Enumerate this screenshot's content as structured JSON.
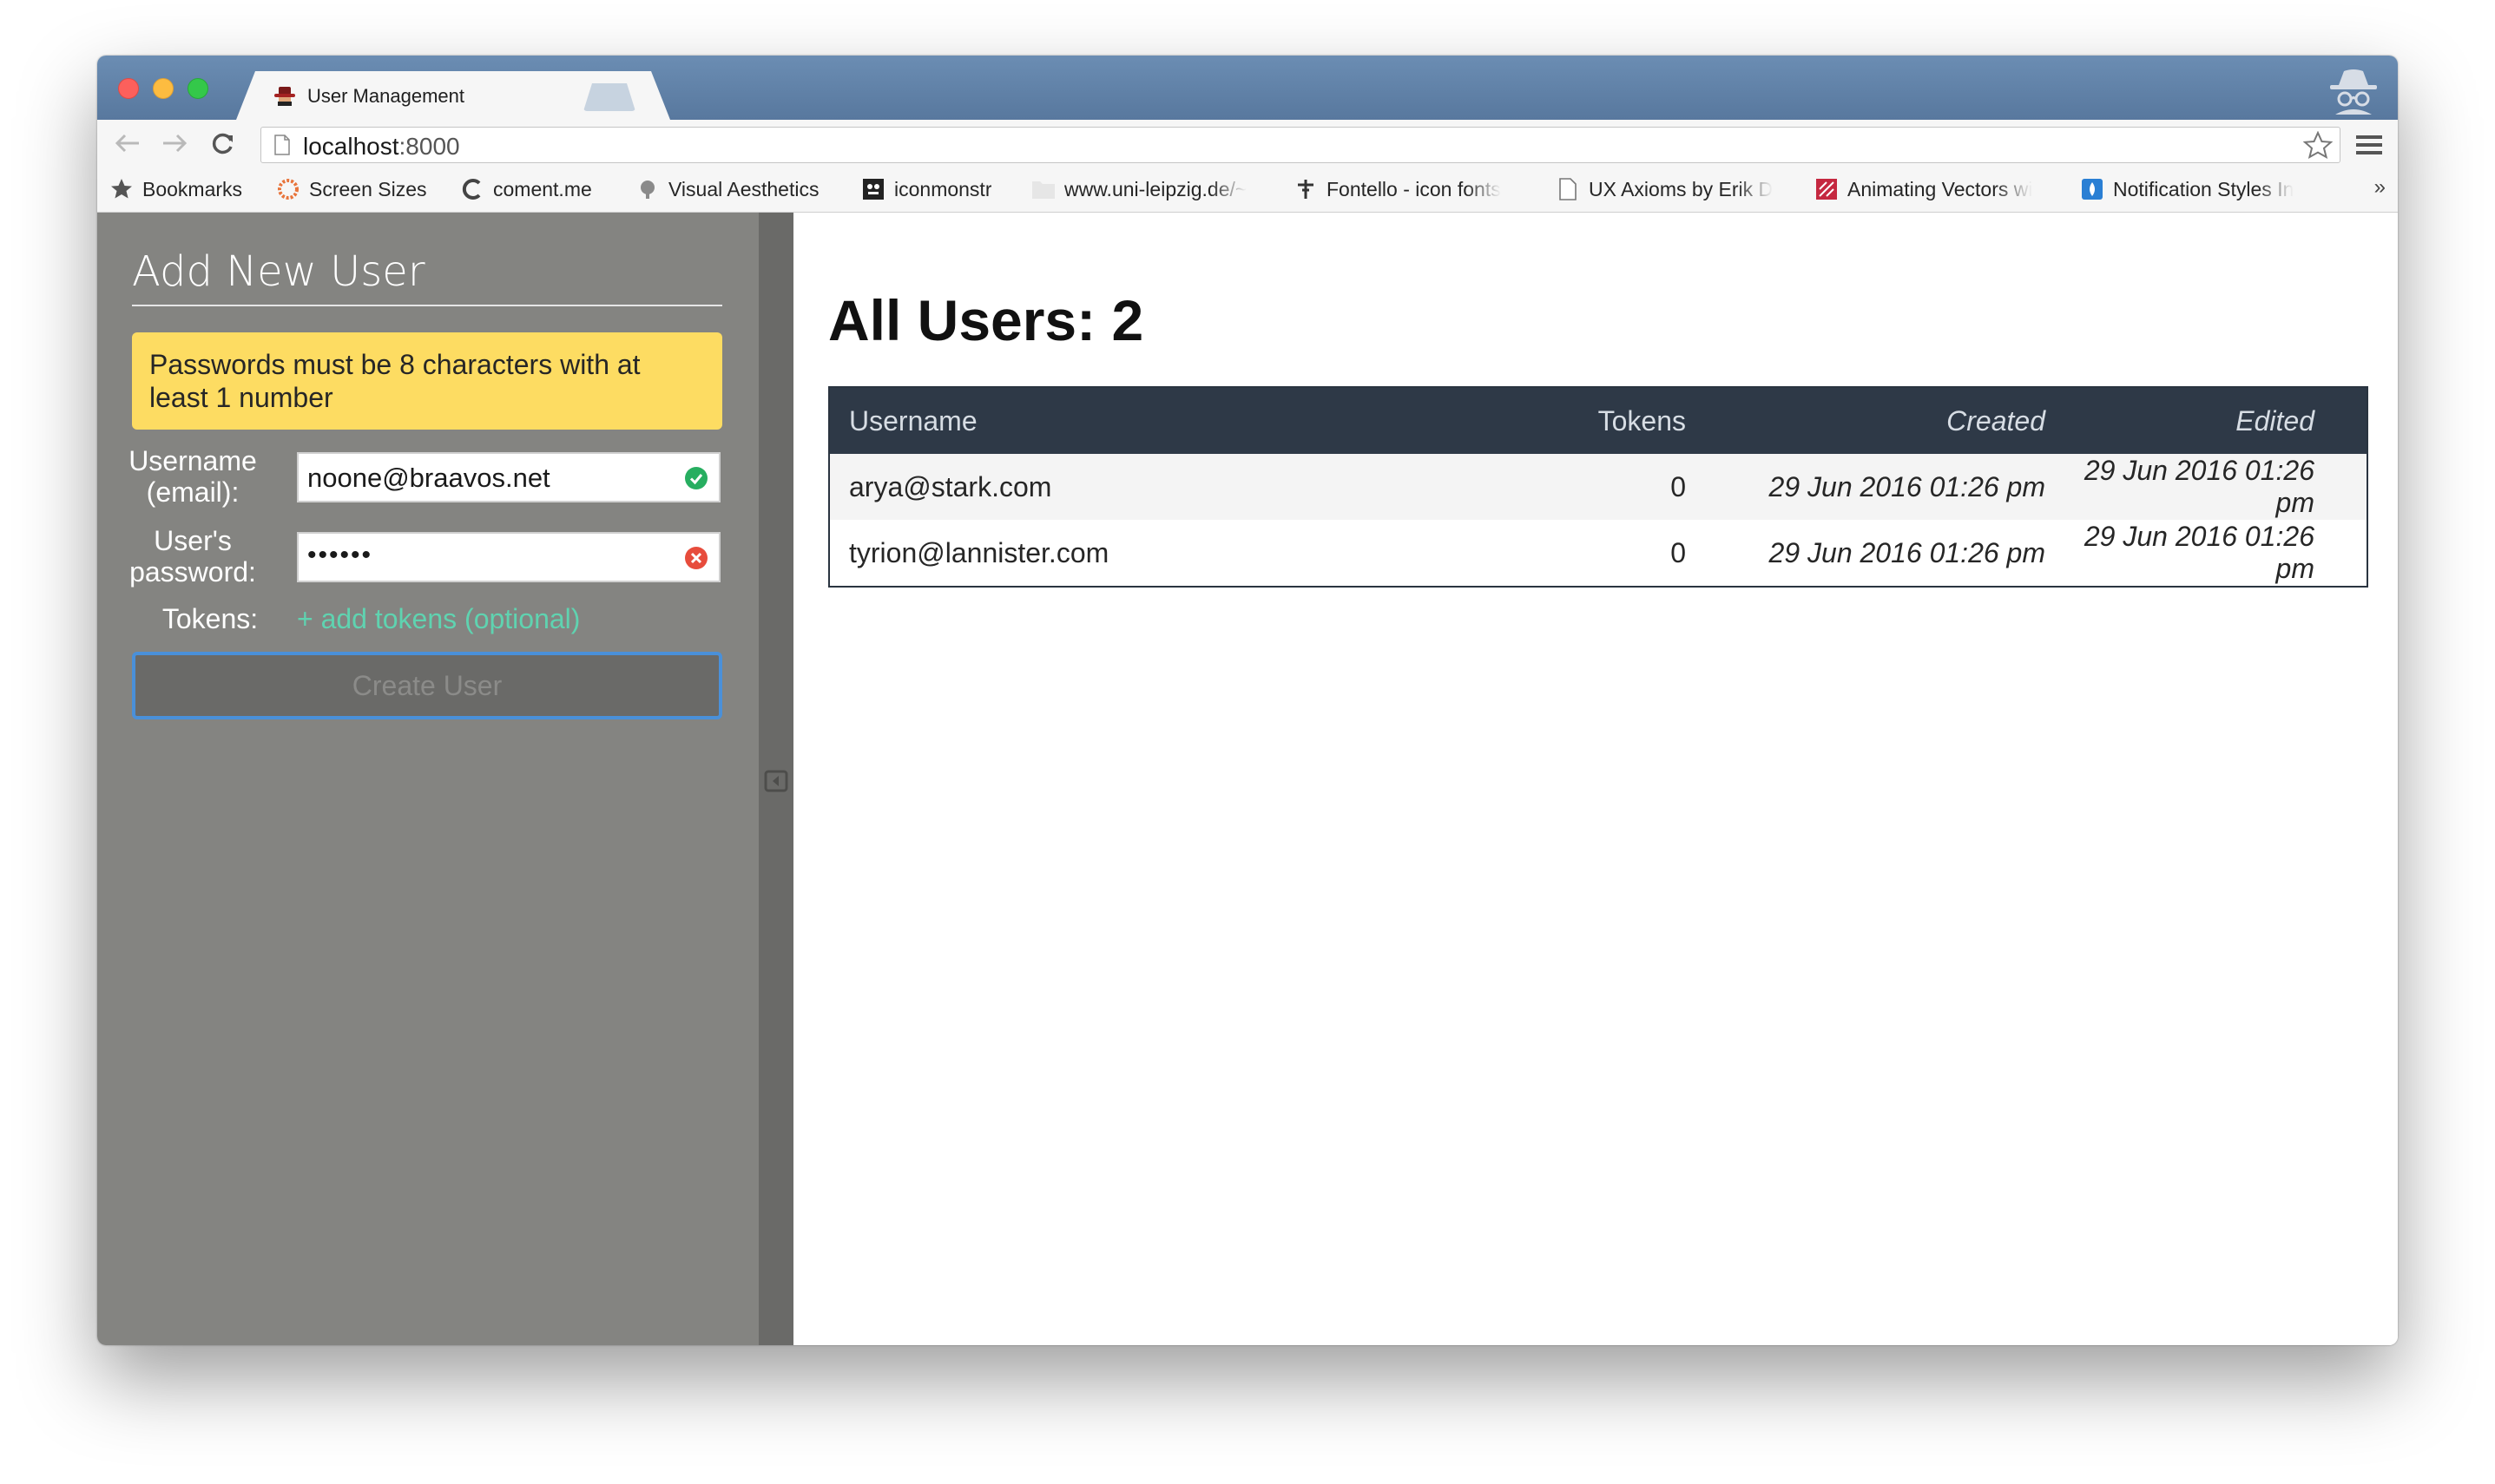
{
  "browser": {
    "tab_title": "User Management",
    "tab_close": "×",
    "url_host": "localhost",
    "url_port": ":8000",
    "bookmarks": [
      {
        "label": "Bookmarks",
        "icon": "star-icon"
      },
      {
        "label": "Screen Sizes",
        "icon": "screen-sizes-icon"
      },
      {
        "label": "coment.me",
        "icon": "coment-icon"
      },
      {
        "label": "Visual Aesthetics",
        "icon": "visual-aesthetics-icon"
      },
      {
        "label": "iconmonstr",
        "icon": "iconmonstr-icon"
      },
      {
        "label": "www.uni-leipzig.de/~",
        "icon": "folder-icon"
      },
      {
        "label": "Fontello - icon fonts",
        "icon": "fontello-icon"
      },
      {
        "label": "UX Axioms by Erik D",
        "icon": "page-icon"
      },
      {
        "label": "Animating Vectors wi",
        "icon": "animating-vectors-icon"
      },
      {
        "label": "Notification Styles In",
        "icon": "notification-icon"
      }
    ],
    "bookmarks_more": "»"
  },
  "sidebar": {
    "title": "Add New User",
    "warning": "Passwords must be 8 characters with at least 1 number",
    "username_label": "Username (email):",
    "username_value": "noone@braavos.net",
    "password_label": "User's password:",
    "password_value": "••••••",
    "tokens_label": "Tokens:",
    "add_tokens": "+ add tokens (optional)",
    "create_button": "Create User"
  },
  "main": {
    "title": "All Users: 2",
    "columns": [
      "Username",
      "Tokens",
      "Created",
      "Edited"
    ],
    "rows": [
      {
        "username": "arya@stark.com",
        "tokens": "0",
        "created": "29 Jun 2016 01:26 pm",
        "edited": "29 Jun 2016 01:26 pm"
      },
      {
        "username": "tyrion@lannister.com",
        "tokens": "0",
        "created": "29 Jun 2016 01:26 pm",
        "edited": "29 Jun 2016 01:26 pm"
      }
    ]
  },
  "colors": {
    "sidebar_bg": "#848481",
    "warning_bg": "#fddc62",
    "table_header_bg": "#2e3947",
    "link_accent": "#5fd3b0",
    "focus_ring": "#4a90d9",
    "valid": "#27ae60",
    "invalid": "#e74c3c"
  }
}
